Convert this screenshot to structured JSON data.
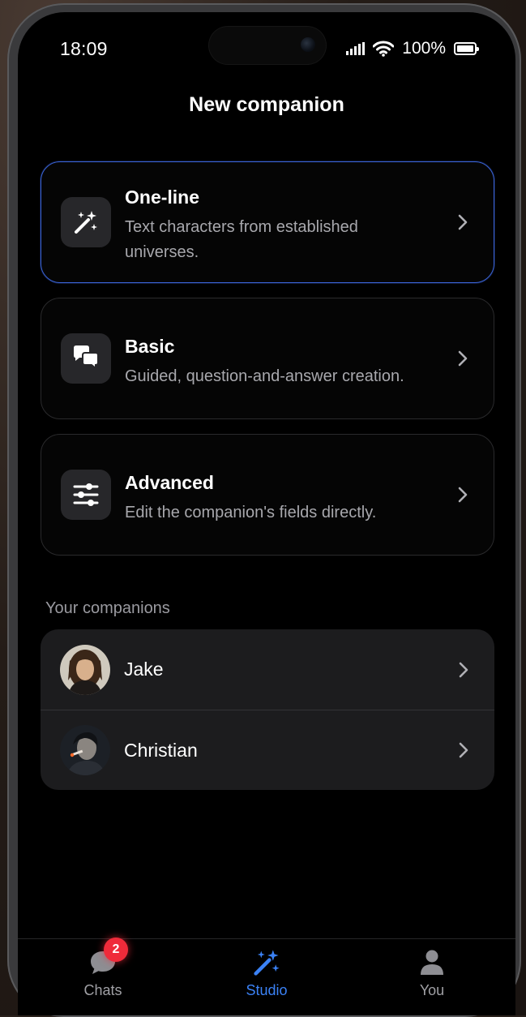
{
  "status_bar": {
    "time": "18:09",
    "battery_percent": "100%",
    "icons": [
      "cellular-signal-icon",
      "wifi-icon",
      "battery-icon"
    ]
  },
  "header": {
    "title": "New companion"
  },
  "options": [
    {
      "title": "One-line",
      "description": "Text characters from established universes.",
      "icon": "magic-wand-icon",
      "selected": true
    },
    {
      "title": "Basic",
      "description": "Guided, question-and-answer creation.",
      "icon": "chat-bubbles-icon",
      "selected": false
    },
    {
      "title": "Advanced",
      "description": "Edit the companion's fields directly.",
      "icon": "sliders-icon",
      "selected": false
    }
  ],
  "companions": {
    "section_label": "Your companions",
    "items": [
      {
        "name": "Jake"
      },
      {
        "name": "Christian"
      }
    ]
  },
  "tabbar": {
    "tabs": [
      {
        "label": "Chats",
        "icon": "chat-bubble-icon",
        "badge": "2"
      },
      {
        "label": "Studio",
        "icon": "magic-wand-icon",
        "active": true
      },
      {
        "label": "You",
        "icon": "person-icon"
      }
    ]
  },
  "colors": {
    "accent": "#3b82f6",
    "badge": "#ef2b3a",
    "background": "#000000",
    "card": "#1c1c1e"
  }
}
